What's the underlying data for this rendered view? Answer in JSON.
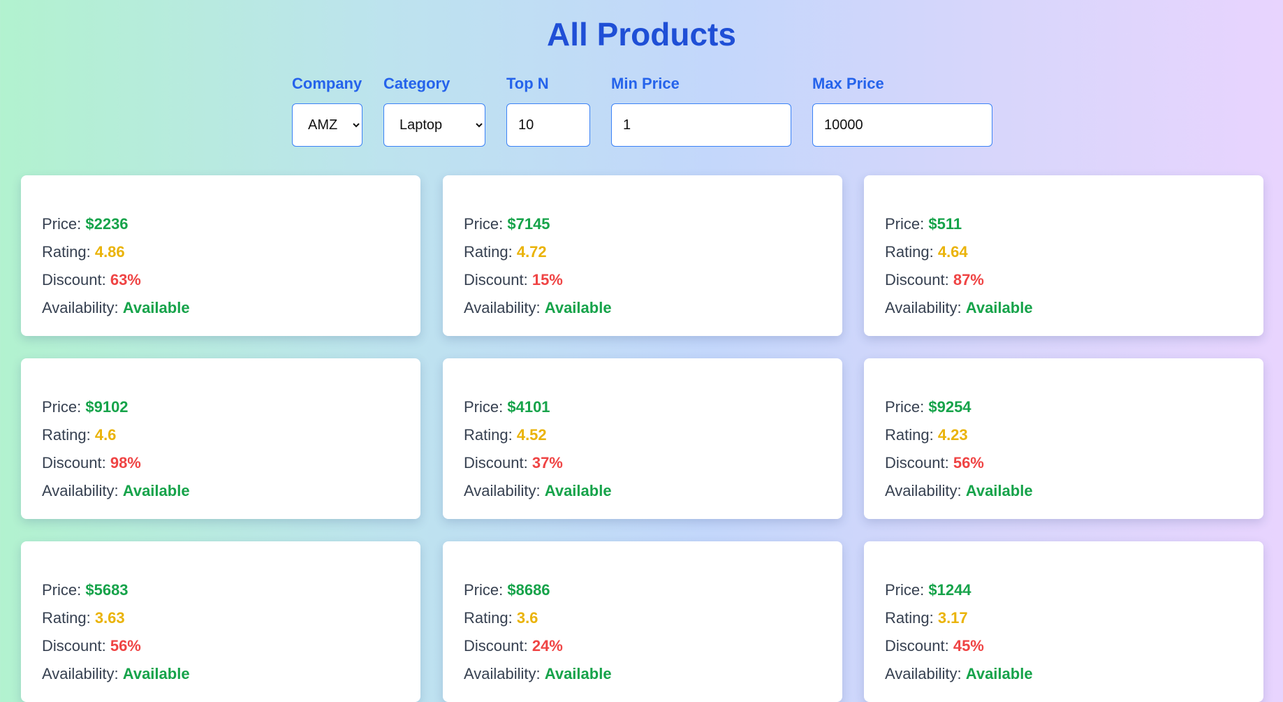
{
  "page": {
    "title": "All Products"
  },
  "filters": {
    "company": {
      "label": "Company",
      "value": "AMZ"
    },
    "category": {
      "label": "Category",
      "value": "Laptop"
    },
    "top_n": {
      "label": "Top N",
      "value": "10"
    },
    "min_price": {
      "label": "Min Price",
      "value": "1"
    },
    "max_price": {
      "label": "Max Price",
      "value": "10000"
    }
  },
  "labels": {
    "price": "Price: ",
    "rating": "Rating: ",
    "discount": "Discount: ",
    "availability": "Availability: "
  },
  "products": [
    {
      "price": "$2236",
      "rating": "4.86",
      "discount": "63%",
      "availability": "Available"
    },
    {
      "price": "$7145",
      "rating": "4.72",
      "discount": "15%",
      "availability": "Available"
    },
    {
      "price": "$511",
      "rating": "4.64",
      "discount": "87%",
      "availability": "Available"
    },
    {
      "price": "$9102",
      "rating": "4.6",
      "discount": "98%",
      "availability": "Available"
    },
    {
      "price": "$4101",
      "rating": "4.52",
      "discount": "37%",
      "availability": "Available"
    },
    {
      "price": "$9254",
      "rating": "4.23",
      "discount": "56%",
      "availability": "Available"
    },
    {
      "price": "$5683",
      "rating": "3.63",
      "discount": "56%",
      "availability": "Available"
    },
    {
      "price": "$8686",
      "rating": "3.6",
      "discount": "24%",
      "availability": "Available"
    },
    {
      "price": "$1244",
      "rating": "3.17",
      "discount": "45%",
      "availability": "Available"
    }
  ],
  "colors": {
    "title": "#1f4fd6",
    "label": "#2563eb",
    "price": "#16a34a",
    "rating": "#eab308",
    "discount": "#ef4444",
    "availability": "#16a34a"
  }
}
